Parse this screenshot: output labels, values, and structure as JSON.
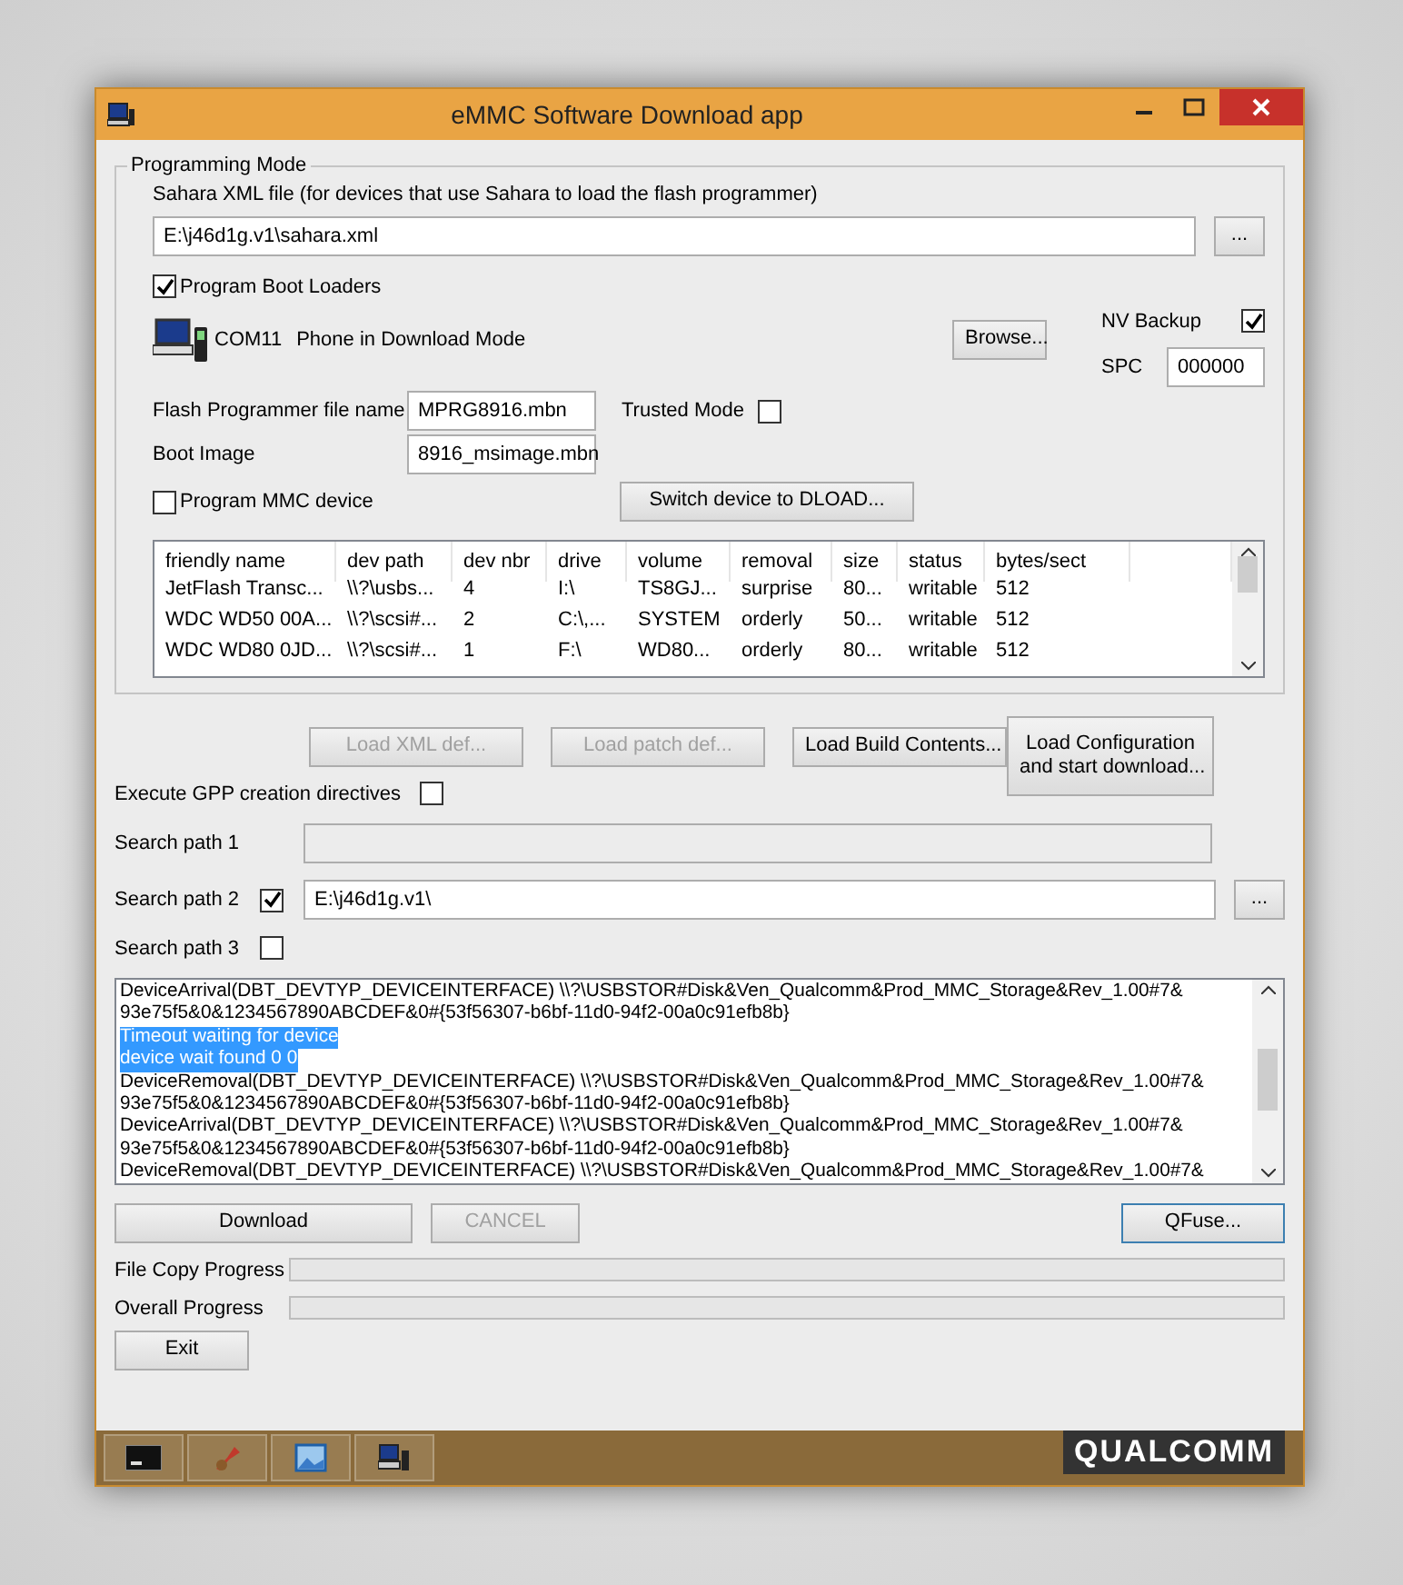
{
  "window": {
    "title": "eMMC Software Download app"
  },
  "programming_mode": {
    "title": "Programming Mode",
    "sahara_label": "Sahara XML file (for devices that use Sahara to load the flash programmer)",
    "sahara_value": "E:\\j46d1g.v1\\sahara.xml",
    "sahara_browse": "...",
    "program_boot_loaders": {
      "label": "Program Boot Loaders",
      "checked": true
    },
    "port": "COM11",
    "port_status": "Phone in Download Mode",
    "browse_button": "Browse...",
    "nv_backup": {
      "label": "NV Backup",
      "checked": true
    },
    "spc": {
      "label": "SPC",
      "value": "000000"
    },
    "flash_programmer": {
      "label": "Flash Programmer file name",
      "value": "MPRG8916.mbn"
    },
    "trusted_mode": {
      "label": "Trusted Mode",
      "checked": false
    },
    "boot_image": {
      "label": "Boot Image",
      "value": "8916_msimage.mbn"
    },
    "program_mmc": {
      "label": "Program MMC device",
      "checked": false
    },
    "switch_button": "Switch device to DLOAD...",
    "table": {
      "columns": [
        "friendly name",
        "dev path",
        "dev nbr",
        "drive",
        "volume",
        "removal",
        "size",
        "status",
        "bytes/sect"
      ],
      "rows": [
        [
          "JetFlash Transc...",
          "\\\\?\\usbs...",
          "4",
          "I:\\",
          "TS8GJ...",
          "surprise",
          "80...",
          "writable",
          "512"
        ],
        [
          "WDC WD50 00A...",
          "\\\\?\\scsi#...",
          "2",
          "C:\\,...",
          "SYSTEM",
          "orderly",
          "50...",
          "writable",
          "512"
        ],
        [
          "WDC WD80 0JD...",
          "\\\\?\\scsi#...",
          "1",
          "F:\\",
          "WD80...",
          "orderly",
          "80...",
          "writable",
          "512"
        ]
      ]
    }
  },
  "load_buttons": [
    {
      "label": "Load XML def...",
      "disabled": true
    },
    {
      "label": "Load patch def...",
      "disabled": true
    },
    {
      "label": "Load Build Contents...",
      "disabled": false
    }
  ],
  "load_config_button": [
    "Load Configuration",
    "and start download..."
  ],
  "execute_gpp": {
    "label": "Execute GPP creation directives",
    "checked": false
  },
  "search_paths": [
    {
      "label": "Search path 1",
      "kind": "plain",
      "disabled": true
    },
    {
      "label": "Search path 2",
      "kind": "checkbox",
      "checked": true,
      "value": "E:\\j46d1g.v1\\",
      "disabled": false,
      "browse": "..."
    },
    {
      "label": "Search path 3",
      "kind": "checkbox",
      "checked": false
    }
  ],
  "log": [
    {
      "text": "DeviceArrival(DBT_DEVTYP_DEVICEINTERFACE) \\\\?\\USBSTOR#Disk&Ven_Qualcomm&Prod_MMC_Storage&Rev_1.00#7&",
      "selected": false
    },
    {
      "text": "93e75f5&0&1234567890ABCDEF&0#{53f56307-b6bf-11d0-94f2-00a0c91efb8b}",
      "selected": false
    },
    {
      "text": "Timeout waiting for device",
      "selected": true
    },
    {
      "text": "device wait found 0 0",
      "selected": true
    },
    {
      "text": "DeviceRemoval(DBT_DEVTYP_DEVICEINTERFACE) \\\\?\\USBSTOR#Disk&Ven_Qualcomm&Prod_MMC_Storage&Rev_1.00#7&",
      "selected": false
    },
    {
      "text": "93e75f5&0&1234567890ABCDEF&0#{53f56307-b6bf-11d0-94f2-00a0c91efb8b}",
      "selected": false
    },
    {
      "text": "DeviceArrival(DBT_DEVTYP_DEVICEINTERFACE) \\\\?\\USBSTOR#Disk&Ven_Qualcomm&Prod_MMC_Storage&Rev_1.00#7&",
      "selected": false
    },
    {
      "text": "93e75f5&0&1234567890ABCDEF&0#{53f56307-b6bf-11d0-94f2-00a0c91efb8b}",
      "selected": false
    },
    {
      "text": "DeviceRemoval(DBT_DEVTYP_DEVICEINTERFACE) \\\\?\\USBSTOR#Disk&Ven_Qualcomm&Prod_MMC_Storage&Rev_1.00#7&",
      "selected": false
    }
  ],
  "action_buttons": [
    {
      "label": "Download",
      "disabled": false
    },
    {
      "label": "CANCEL",
      "disabled": true
    }
  ],
  "qfuse_button": "QFuse...",
  "progress": [
    {
      "label": "File Copy Progress",
      "level": 0
    },
    {
      "label": "Overall Progress",
      "level": 0
    }
  ],
  "exit_button": "Exit",
  "logo": "QUALCOMM"
}
